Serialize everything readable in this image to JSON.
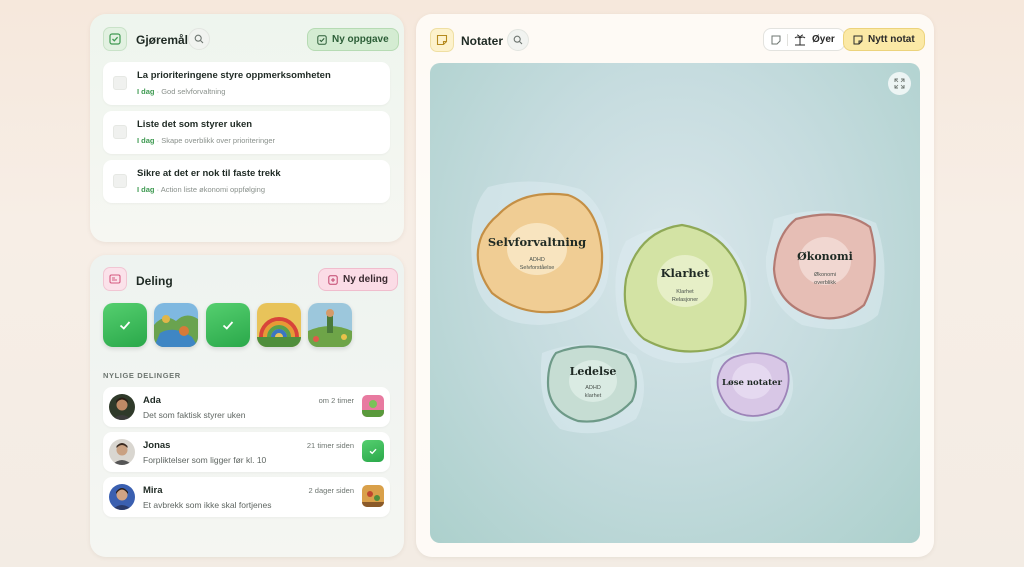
{
  "todo": {
    "title": "Gjøremål",
    "new_button": "Ny oppgave",
    "tasks": [
      {
        "title": "La prioriteringene styre oppmerksomheten",
        "due": "I dag",
        "sep": "·",
        "context": "God selvforvaltning"
      },
      {
        "title": "Liste det som styrer uken",
        "due": "I dag",
        "sep": "·",
        "context": "Skape overblikk over prioriteringer"
      },
      {
        "title": "Sikre at det er nok til faste trekk",
        "due": "I dag",
        "sep": "·",
        "context": "Action liste økonomi oppfølging"
      }
    ]
  },
  "sharing": {
    "title": "Deling",
    "new_button": "Ny deling",
    "recent_label": "NYLIGE DELINGER",
    "thumbnails": [
      "checkmark-tile",
      "landscape-painting",
      "checkmark-tile",
      "rainbow-painting",
      "figure-painting"
    ],
    "items": [
      {
        "name": "Ada",
        "message": "Det som faktisk styrer uken",
        "time": "om 2 timer"
      },
      {
        "name": "Jonas",
        "message": "Forpliktelser som ligger før kl. 10",
        "time": "21 timer siden"
      },
      {
        "name": "Mira",
        "message": "Et avbrekk som ikke skal fortjenes",
        "time": "2 dager siden"
      }
    ]
  },
  "notes": {
    "title": "Notater",
    "islands_button": "Øyer",
    "new_button": "Nytt notat",
    "islands": [
      {
        "name": "Selvforvaltning",
        "lines": [
          "ADHD",
          "Selvforståelse"
        ],
        "color": "#f0cd94"
      },
      {
        "name": "Klarhet",
        "lines": [
          "Klarhet",
          "Relasjoner"
        ],
        "color": "#d3e3a4"
      },
      {
        "name": "Økonomi",
        "lines": [
          "Økonomi",
          "overblikk"
        ],
        "color": "#e6beb5"
      },
      {
        "name": "Ledelse",
        "lines": [
          "ADHD",
          "klarhet"
        ],
        "color": "#c6ddd3"
      },
      {
        "name": "Løse notater",
        "lines": [],
        "color": "#d8c7e6"
      }
    ]
  },
  "colors": {
    "accent_green": "#3f9a52",
    "share_pink": "#f9dde6",
    "notes_yellow": "#fbe9a6"
  }
}
